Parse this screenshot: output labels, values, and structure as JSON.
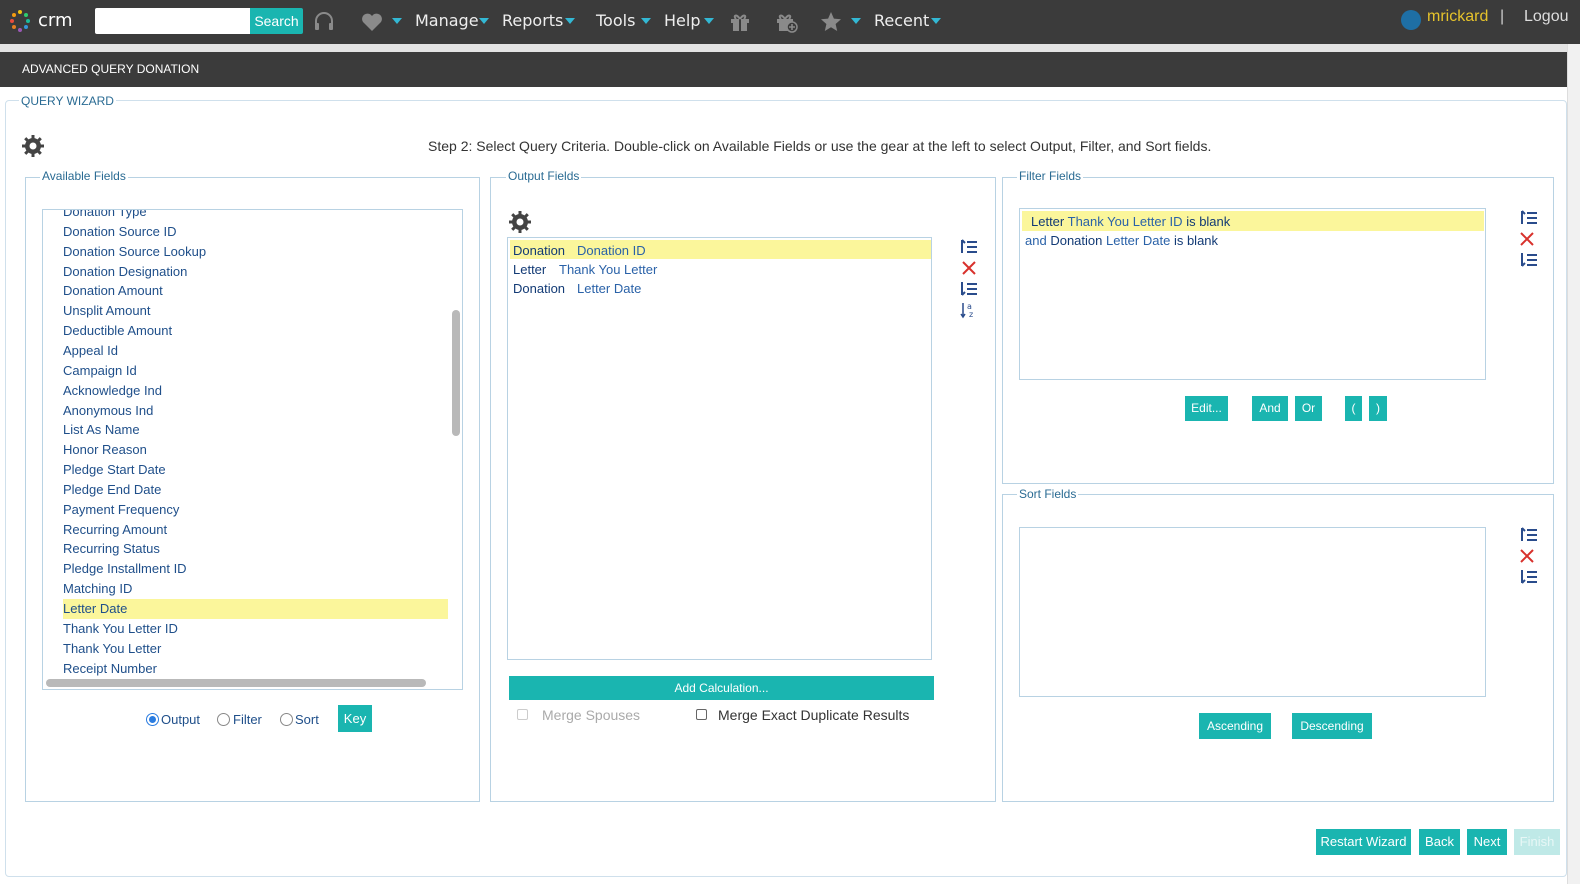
{
  "app": {
    "logo_text": "crm"
  },
  "search": {
    "placeholder": "",
    "button_label": "Search"
  },
  "nav": {
    "manage": "Manage",
    "reports": "Reports",
    "tools": "Tools",
    "help": "Help",
    "recent": "Recent",
    "user": "mrickard",
    "separator": "|",
    "logout": "Logou"
  },
  "page": {
    "title": "ADVANCED QUERY DONATION"
  },
  "wizard": {
    "legend": "QUERY WIZARD",
    "step_text": "Step 2: Select Query Criteria. Double-click on Available Fields or use the gear at the left to select Output, Filter, and Sort fields."
  },
  "available_fields": {
    "legend": "Available Fields",
    "items": [
      "Donation Type",
      "Donation Source ID",
      "Donation Source Lookup",
      "Donation Designation",
      "Donation Amount",
      "Unsplit Amount",
      "Deductible Amount",
      "Appeal Id",
      "Campaign Id",
      "Acknowledge Ind",
      "Anonymous Ind",
      "List As Name",
      "Honor Reason",
      "Pledge Start Date",
      "Pledge End Date",
      "Payment Frequency",
      "Recurring Amount",
      "Recurring Status",
      "Pledge Installment ID",
      "Matching ID",
      "Letter Date",
      "Thank You Letter ID",
      "Thank You Letter",
      "Receipt Number"
    ],
    "selected": "Letter Date",
    "radios": {
      "output": "Output",
      "filter": "Filter",
      "sort": "Sort"
    },
    "selected_mode": "Output",
    "key_button": "Key"
  },
  "output_fields": {
    "legend": "Output Fields",
    "rows": [
      {
        "object": "Donation",
        "field": "Donation ID"
      },
      {
        "object": "Letter",
        "field": "Thank You Letter"
      },
      {
        "object": "Donation",
        "field": "Letter Date"
      }
    ],
    "add_calculation": "Add Calculation...",
    "merge_spouses": "Merge Spouses",
    "merge_exact": "Merge Exact Duplicate Results"
  },
  "filter_fields": {
    "legend": "Filter Fields",
    "rows": [
      {
        "conj": "",
        "object": "Letter",
        "field": "Thank You Letter ID",
        "op": "is blank"
      },
      {
        "conj": "and",
        "object": "Donation",
        "field": "Letter Date",
        "op": "is blank"
      }
    ],
    "buttons": {
      "edit": "Edit...",
      "and": "And",
      "or": "Or",
      "open_paren": "(",
      "close_paren": ")"
    }
  },
  "sort_fields": {
    "legend": "Sort Fields",
    "ascending": "Ascending",
    "descending": "Descending"
  },
  "footer": {
    "restart": "Restart Wizard",
    "back": "Back",
    "next": "Next",
    "finish": "Finish"
  },
  "colors": {
    "accent": "#1ab5b0",
    "highlight": "#fbf69b",
    "topbar": "#3b3b3b",
    "user": "#e6c32b"
  }
}
